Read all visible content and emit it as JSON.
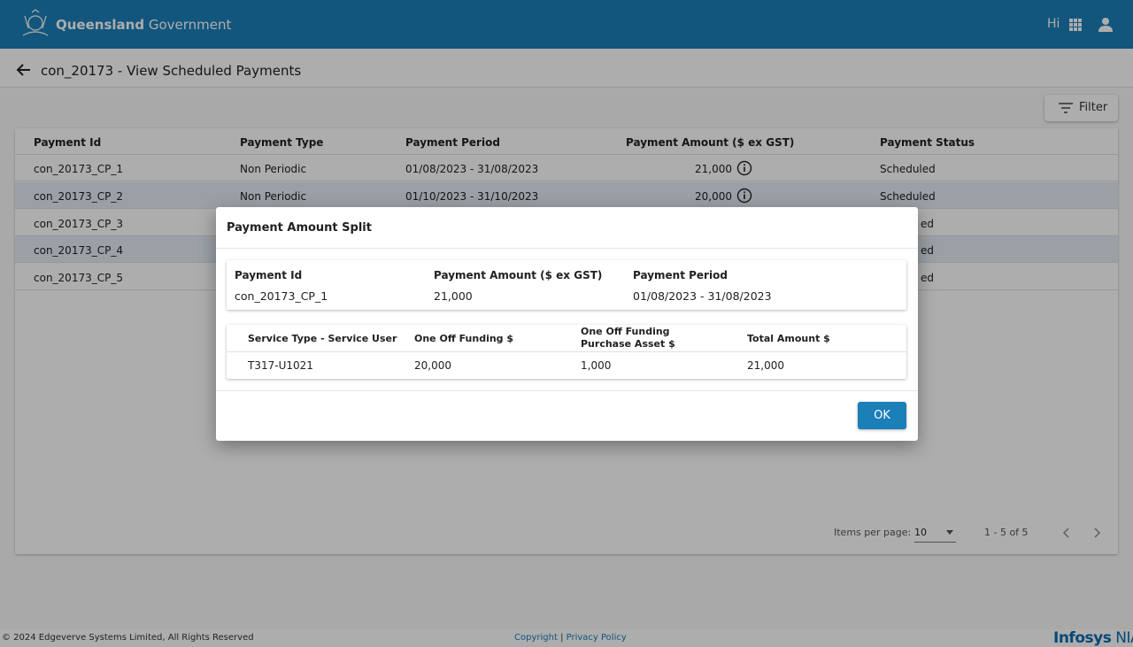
{
  "header": {
    "brand_bold": "Queensland",
    "brand_rest": " Government",
    "greeting": "Hi",
    "apps_icon": "apps-grid-icon",
    "user_icon": "account-icon"
  },
  "page": {
    "title": "con_20173 - View Scheduled Payments",
    "filter_label": "Filter"
  },
  "table": {
    "columns": [
      "Payment Id",
      "Payment Type",
      "Payment Period",
      "Payment Amount ($ ex GST)",
      "Payment Status"
    ],
    "rows": [
      {
        "id": "con_20173_CP_1",
        "type": "Non Periodic",
        "period": "01/08/2023 - 31/08/2023",
        "amount": "21,000",
        "status": "Scheduled"
      },
      {
        "id": "con_20173_CP_2",
        "type": "Non Periodic",
        "period": "01/10/2023 - 31/10/2023",
        "amount": "20,000",
        "status": "Scheduled"
      },
      {
        "id": "con_20173_CP_3",
        "status": "ed"
      },
      {
        "id": "con_20173_CP_4",
        "status": "ed"
      },
      {
        "id": "con_20173_CP_5",
        "status": "ed"
      }
    ]
  },
  "paginator": {
    "items_per_page_label": "Items per page:",
    "items_per_page_value": "10",
    "range": "1 - 5 of 5"
  },
  "dialog": {
    "title": "Payment Amount Split",
    "summary": {
      "h_id": "Payment Id",
      "h_amount": "Payment Amount ($ ex GST)",
      "h_period": "Payment Period",
      "id": "con_20173_CP_1",
      "amount": "21,000",
      "period": "01/08/2023 - 31/08/2023"
    },
    "split": {
      "h_service": "Service Type - Service User",
      "h_oneoff": "One Off Funding $",
      "h_asset": "One Off Funding Purchase Asset $",
      "h_total": "Total Amount $",
      "service": "T317-U1021",
      "oneoff": "20,000",
      "asset": "1,000",
      "total": "21,000"
    },
    "ok_label": "OK"
  },
  "footer": {
    "copyright": "© 2024 Edgeverve Systems Limited, All Rights Reserved",
    "copyright_link": "Copyright",
    "separator": "|",
    "privacy_link": "Privacy Policy",
    "logo_main": "Infosys",
    "logo_suffix": "NIA"
  },
  "colors": {
    "brand": "#1b7fb8",
    "row_highlight": "#e3ecf5"
  }
}
